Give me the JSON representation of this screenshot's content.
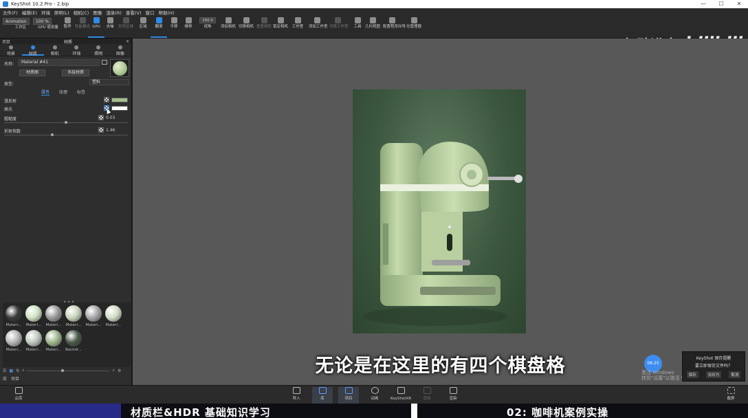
{
  "window": {
    "title": "KeyShot 10.2 Pro - 2.bip",
    "controls": [
      "—",
      "☐",
      "✕"
    ]
  },
  "menu": [
    "文件(F)",
    "编辑(E)",
    "环境",
    "照明(L)",
    "相机(C)",
    "图像",
    "渲染(R)",
    "查看(V)",
    "窗口",
    "帮助(H)"
  ],
  "toolbar": {
    "mode_select": "Animation",
    "zoom_select": "100 %",
    "fov_value": "150.0",
    "tools": [
      "工作区",
      "GPU 使用量",
      "暂停",
      "性能模式",
      "GPU",
      "去噪",
      "实时区域",
      "区域",
      "翻滚",
      "平移",
      "推移",
      "视角",
      "添加相机",
      "切换相机",
      "重置相机",
      "锁定相机",
      "工作室",
      "添加工作室",
      "切换工作室",
      "工具",
      "几何视图",
      "配置程序向导",
      "光管理器"
    ]
  },
  "watermark": {
    "text": "亿點进步",
    "logo": "bilibili"
  },
  "panel": {
    "header_left": "项目",
    "header_title": "材质",
    "tabs": [
      "场景",
      "材质",
      "相机",
      "环境",
      "照明",
      "图像"
    ],
    "name_label": "名称:",
    "name_value": "Material #41",
    "material_graph_btn": "材质图",
    "multi_material_btn": "多层材质",
    "type_label": "类型:",
    "type_value": "塑料",
    "subtabs": [
      "属性",
      "纹理",
      "标签"
    ],
    "props": [
      {
        "label": "漫反射",
        "color": "#a5be8e"
      },
      {
        "label": "高光",
        "color": "#ffffff"
      },
      {
        "label": "粗糙度",
        "value": "0.03"
      },
      {
        "label": "折射指数",
        "value": "1.46"
      }
    ]
  },
  "library": {
    "materials": [
      {
        "label": "Materi...",
        "color": "#3a3a3a"
      },
      {
        "label": "Materi...",
        "color": "#cfe2c4"
      },
      {
        "label": "Materi...",
        "color": "#9a9a9a"
      },
      {
        "label": "Materi...",
        "color": "#c8d4bb"
      },
      {
        "label": "Materi...",
        "color": "#a7a7a7"
      },
      {
        "label": "Materi...",
        "color": "#d4dcc6"
      },
      {
        "label": "Materi...",
        "color": "#b7b7b7"
      },
      {
        "label": "Materi...",
        "color": "#bfc8bf"
      },
      {
        "label": "Materi...",
        "color": "#9fb68d"
      },
      {
        "label": "Backdr...",
        "color": "#4b5a4b"
      }
    ],
    "bottom_tabs": [
      "库",
      "项目"
    ]
  },
  "viewport": {
    "subtitle": "无论是在这里的有四个棋盘格",
    "timer": "06:25",
    "activate_lines": [
      "激活 Windows",
      "转到\"设置\"以激活 Windows。"
    ],
    "save_dialog": {
      "title": "KeyShot 保存提醒",
      "message": "要立即保存文件吗？",
      "buttons": [
        "保存",
        "另存为",
        "取消"
      ]
    }
  },
  "appbar": {
    "items": [
      "云库",
      "导入",
      "库",
      "项目",
      "动画",
      "KeyShotXR",
      "渲染",
      "渲染"
    ],
    "screenshot": "截屏"
  },
  "banner": {
    "left": "材质栏&HDR 基础知识学习",
    "right": "02: 咖啡机案例实操"
  }
}
